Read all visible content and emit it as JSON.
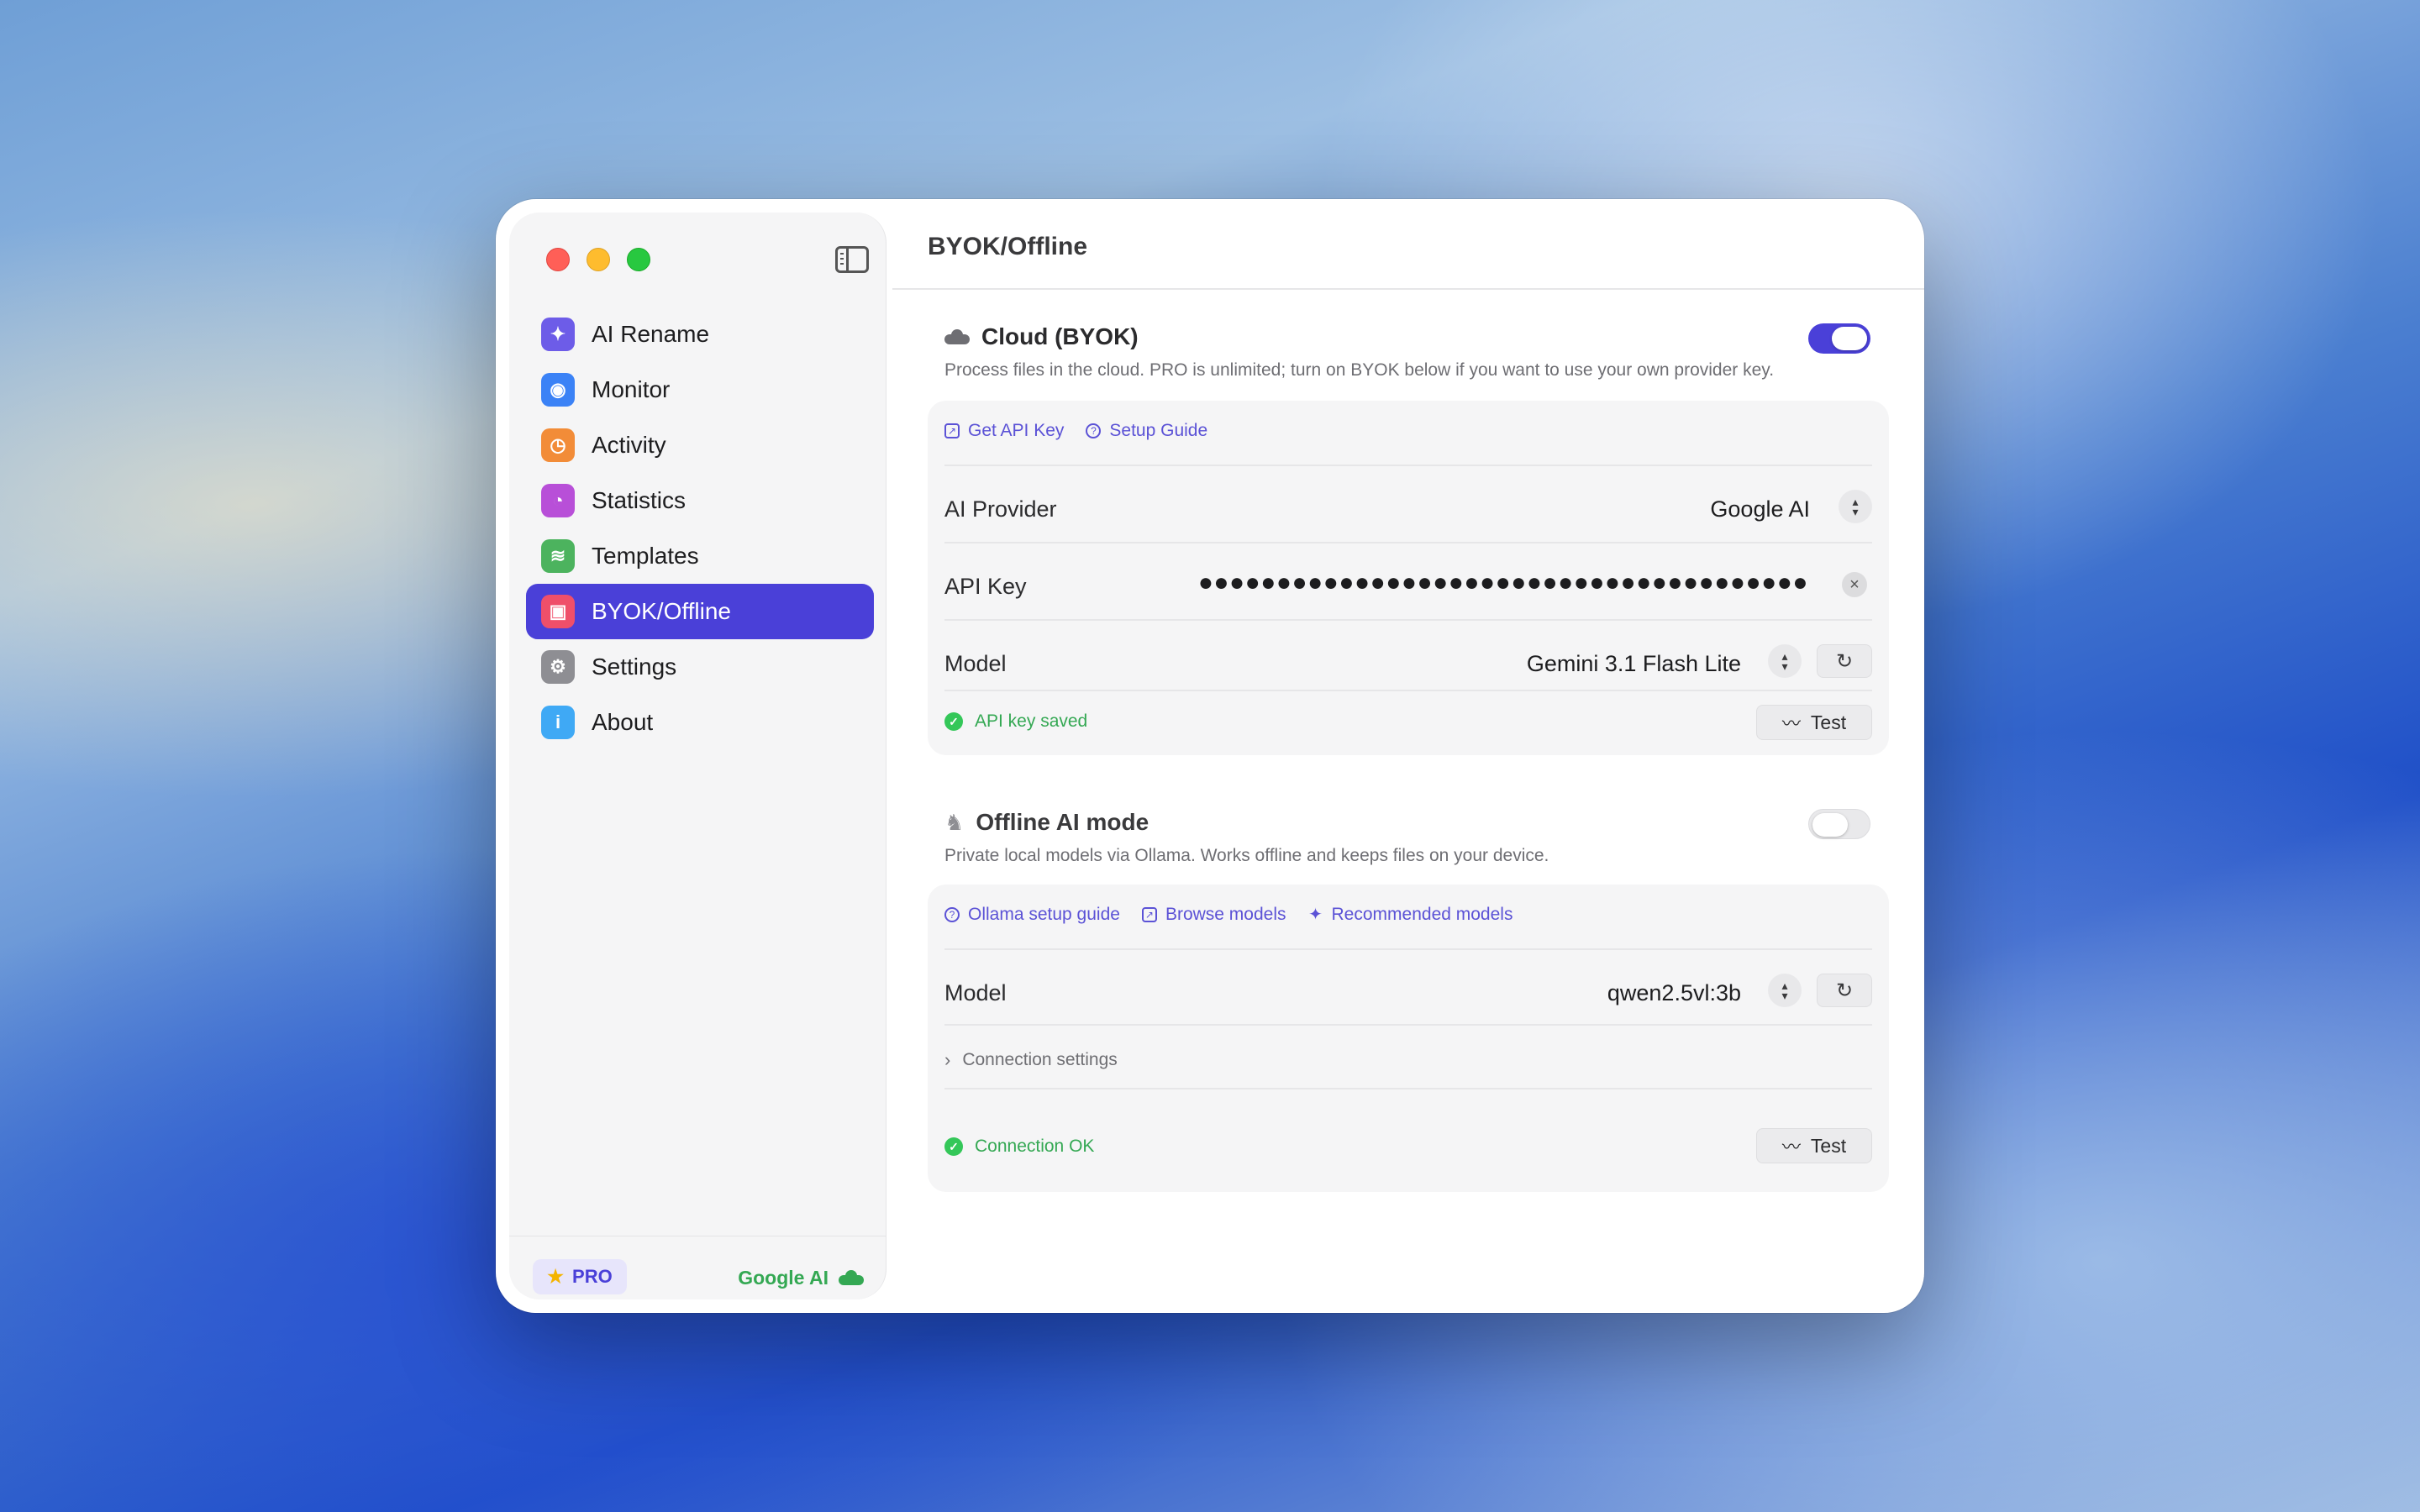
{
  "window": {
    "title": "BYOK/Offline"
  },
  "sidebar": {
    "items": [
      {
        "label": "AI Rename",
        "icon": "sparkles-icon",
        "color": "#6d5ce8"
      },
      {
        "label": "Monitor",
        "icon": "eye-icon",
        "color": "#3b82f6"
      },
      {
        "label": "Activity",
        "icon": "clock-icon",
        "color": "#f28c38"
      },
      {
        "label": "Statistics",
        "icon": "pie-chart-icon",
        "color": "#b84fd8"
      },
      {
        "label": "Templates",
        "icon": "layers-icon",
        "color": "#4cb35e"
      },
      {
        "label": "BYOK/Offline",
        "icon": "chip-icon",
        "color": "#ef4f6a"
      },
      {
        "label": "Settings",
        "icon": "gear-icon",
        "color": "#8e8e93"
      },
      {
        "label": "About",
        "icon": "info-icon",
        "color": "#3fa9f5"
      }
    ],
    "active_index": 5,
    "footer": {
      "pro_label": "PRO",
      "provider_label": "Google AI"
    }
  },
  "cloud": {
    "title": "Cloud (BYOK)",
    "description": "Process files in the cloud. PRO is unlimited; turn on BYOK below if you want to use your own provider key.",
    "enabled": true,
    "links": {
      "get_api_key": "Get API Key",
      "setup_guide": "Setup Guide"
    },
    "provider_label": "AI Provider",
    "provider_value": "Google AI",
    "api_key_label": "API Key",
    "api_key_value": "●●●●●●●●●●●●●●●●●●●●●●●●●●●●●●●●●●●●●●●",
    "model_label": "Model",
    "model_value": "Gemini 3.1 Flash Lite",
    "status": "API key saved",
    "test_label": "Test"
  },
  "offline": {
    "title": "Offline AI mode",
    "description": "Private local models via Ollama. Works offline and keeps files on your device.",
    "enabled": false,
    "links": {
      "ollama_setup": "Ollama setup guide",
      "browse_models": "Browse models",
      "recommended_models": "Recommended models"
    },
    "model_label": "Model",
    "model_value": "qwen2.5vl:3b",
    "connection_settings": "Connection settings",
    "status": "Connection OK",
    "test_label": "Test"
  },
  "colors": {
    "accent": "#4a40d8",
    "success": "#34a853"
  }
}
